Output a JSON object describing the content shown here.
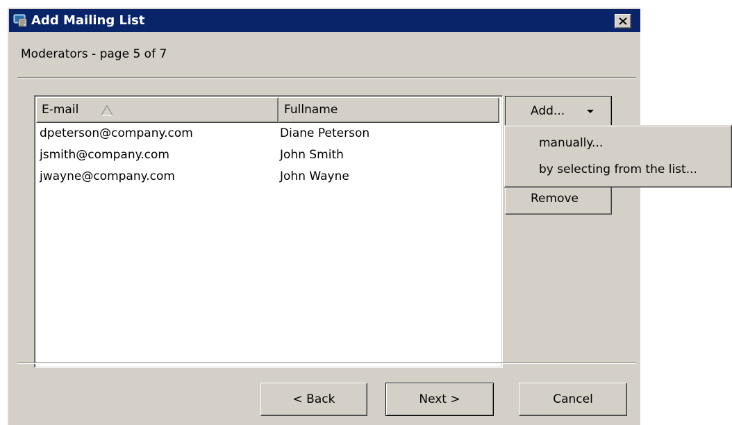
{
  "window": {
    "title": "Add Mailing List",
    "close_glyph": "✕"
  },
  "page": {
    "subtitle": "Moderators - page 5 of 7"
  },
  "table": {
    "columns": [
      "E-mail",
      "Fullname"
    ],
    "sort_column": "E-mail",
    "sort_direction": "ascending",
    "rows": [
      {
        "email": "dpeterson@company.com",
        "fullname": "Diane Peterson"
      },
      {
        "email": "jsmith@company.com",
        "fullname": "John Smith"
      },
      {
        "email": "jwayne@company.com",
        "fullname": "John Wayne"
      }
    ]
  },
  "actions": {
    "add_label": "Add...",
    "remove_label": "Remove"
  },
  "add_menu": {
    "items": [
      "manually...",
      "by selecting from the list..."
    ]
  },
  "footer": {
    "back_label": "< Back",
    "next_label": "Next >",
    "cancel_label": "Cancel"
  },
  "colors": {
    "titlebar": "#0a246a",
    "dialog_face": "#d4d0c8",
    "list_bg": "#ffffff"
  }
}
